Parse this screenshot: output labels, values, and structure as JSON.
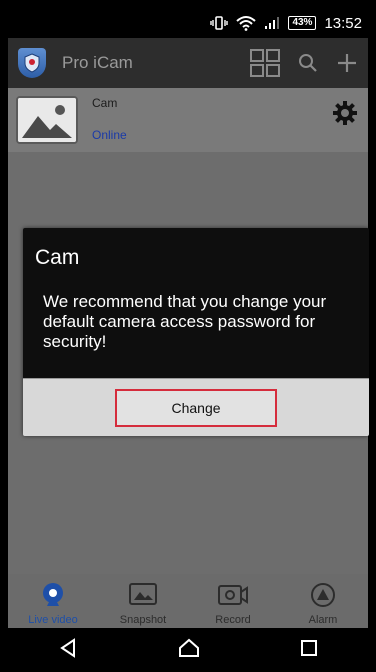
{
  "status_bar": {
    "icons": [
      "vibrate-icon",
      "wifi-icon",
      "signal-icon"
    ],
    "battery": "43%",
    "time": "13:52"
  },
  "app_bar": {
    "title": "Pro iCam",
    "actions": [
      "grid-view-icon",
      "search-icon",
      "add-icon"
    ]
  },
  "camera": {
    "name": "Cam",
    "status": "Online",
    "status_color": "#1a3aa8"
  },
  "dialog": {
    "title": "Cam",
    "message": "We recommend that you change your default camera access password for security!",
    "button_label": "Change",
    "highlight_color": "#d52c3c"
  },
  "bottom_nav": {
    "items": [
      {
        "label": "Live video",
        "icon": "live-video-icon",
        "active": true
      },
      {
        "label": "Snapshot",
        "icon": "snapshot-icon",
        "active": false
      },
      {
        "label": "Record",
        "icon": "record-icon",
        "active": false
      },
      {
        "label": "Alarm",
        "icon": "alarm-icon",
        "active": false
      }
    ]
  },
  "system_nav": [
    "back-icon",
    "home-icon",
    "recents-icon"
  ]
}
